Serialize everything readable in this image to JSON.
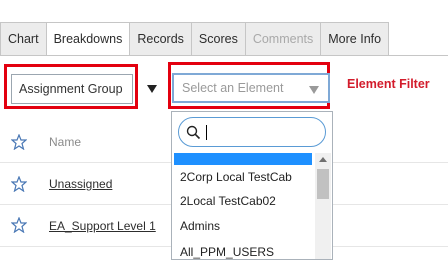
{
  "tabs": [
    {
      "label": "Chart",
      "state": "normal"
    },
    {
      "label": "Breakdowns",
      "state": "active"
    },
    {
      "label": "Records",
      "state": "normal"
    },
    {
      "label": "Scores",
      "state": "normal"
    },
    {
      "label": "Comments",
      "state": "disabled"
    },
    {
      "label": "More Info",
      "state": "normal"
    }
  ],
  "breakdown_select": {
    "value": "Assignment Group"
  },
  "element_select": {
    "placeholder": "Select an Element"
  },
  "annotation": "Element Filter",
  "table": {
    "header": "Name",
    "rows": [
      "Unassigned",
      "EA_Support Level 1"
    ]
  },
  "dropdown": {
    "search_value": "",
    "options": [
      "2Corp Local TestCab",
      "2Local TestCab02",
      "Admins",
      "All_PPM_USERS"
    ]
  },
  "colors": {
    "annotation_red": "#e3000f",
    "highlight": "#1e90ff",
    "star": "#4a78b5",
    "focus_border": "#7fa9d6"
  }
}
